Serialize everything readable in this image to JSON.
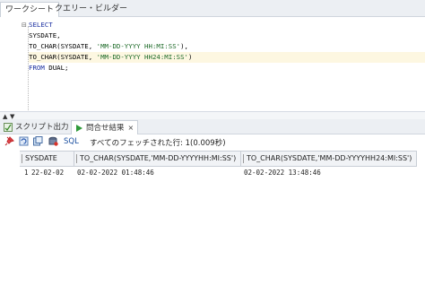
{
  "tabs": {
    "worksheet": "ワークシート",
    "query_builder": "クエリー・ビルダー"
  },
  "editor": {
    "line1": "SELECT",
    "line2": "SYSDATE,",
    "line3_fn": "TO_CHAR(SYSDATE, ",
    "line3_str": "'MM-DD-YYYY HH:MI:SS'",
    "line3_end": "),",
    "line4_fn": "TO_CHAR(SYSDATE, ",
    "line4_str": "'MM-DD-YYYY HH24:MI:SS'",
    "line4_end": ")",
    "line5_kw": "FROM",
    "line5_rest": " DUAL;"
  },
  "output_tabs": {
    "script_output": "スクリプト出力",
    "query_result": "問合せ結果",
    "close": "×"
  },
  "toolbar": {
    "sql_label": "SQL",
    "status": "すべてのフェッチされた行: 1(0.009秒)"
  },
  "grid": {
    "headers": [
      "SYSDATE",
      "TO_CHAR(SYSDATE,'MM-DD-YYYYHH:MI:SS')",
      "TO_CHAR(SYSDATE,'MM-DD-YYYYHH24:MI:SS')"
    ],
    "rows": [
      {
        "num": "1",
        "sysdate": "22-02-02",
        "to_char_12": "02-02-2022 01:48:46",
        "to_char_24": "02-02-2022 13:48:46"
      }
    ]
  },
  "colors": {
    "keyword": "#1a2fa0",
    "string": "#1d6a28",
    "current_line": "#fdf7e1"
  }
}
